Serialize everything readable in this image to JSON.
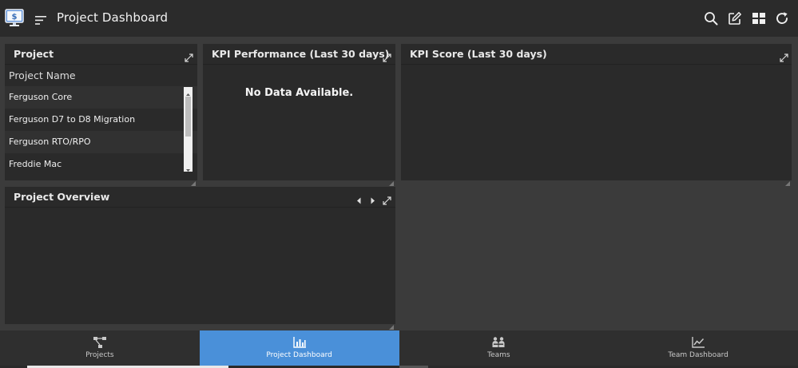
{
  "header": {
    "title": "Project Dashboard",
    "logo_glyph": "$"
  },
  "icons": {
    "app_logo": "monitor-dollar-icon",
    "menu": "menu-lines-icon",
    "search": "search-icon",
    "edit": "edit-icon",
    "layout": "grid-layout-icon",
    "refresh": "refresh-icon"
  },
  "panels": {
    "project": {
      "title": "Project",
      "column_header": "Project Name",
      "items": [
        "Ferguson Core",
        "Ferguson D7 to D8 Migration",
        "Ferguson RTO/RPO",
        "Freddie Mac"
      ]
    },
    "kpi_performance": {
      "title": "KPI Performance (Last 30 days)",
      "empty_message": "No Data Available."
    },
    "kpi_score": {
      "title": "KPI Score (Last 30 days)"
    },
    "project_overview": {
      "title": "Project Overview"
    }
  },
  "bottom_nav": {
    "tabs": [
      {
        "label": "Projects",
        "icon": "projects-icon",
        "active": false
      },
      {
        "label": "Project Dashboard",
        "icon": "bar-chart-icon",
        "active": true
      },
      {
        "label": "Teams",
        "icon": "teams-icon",
        "active": false
      },
      {
        "label": "Team Dashboard",
        "icon": "line-chart-icon",
        "active": false
      }
    ]
  },
  "colors": {
    "accent": "#4a90d9",
    "topbar": "#2b2b2b",
    "panel": "#2a2a2a",
    "background": "#3b3b3b"
  }
}
